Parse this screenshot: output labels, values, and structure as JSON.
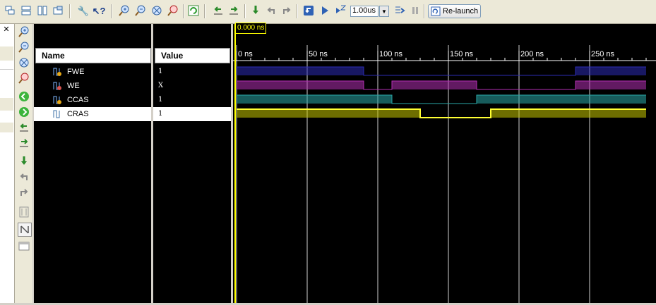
{
  "toolbar": {
    "time_value": "1.00us",
    "relaunch_label": "Re-launch"
  },
  "sidebar": {
    "close": "✕"
  },
  "columns": {
    "name": "Name",
    "value": "Value"
  },
  "signals": [
    {
      "name": "FWE",
      "value": "1",
      "color": "#2b2bb5"
    },
    {
      "name": "WE",
      "value": "X",
      "color": "#b32fb3"
    },
    {
      "name": "CCAS",
      "value": "1",
      "color": "#2aa7a7"
    },
    {
      "name": "CRAS",
      "value": "1",
      "color": "#c8c800"
    }
  ],
  "cursor": {
    "label": "0.000 ns"
  },
  "timeline": {
    "ticks": [
      "0 ns",
      "50 ns",
      "100 ns",
      "150 ns",
      "200 ns",
      "250 ns"
    ]
  },
  "waveforms": [
    {
      "signal": "FWE",
      "segments": [
        [
          0,
          90,
          "high"
        ],
        [
          90,
          240,
          "low"
        ],
        [
          240,
          290,
          "high"
        ]
      ]
    },
    {
      "signal": "WE",
      "segments": [
        [
          0,
          90,
          "high"
        ],
        [
          90,
          110,
          "low"
        ],
        [
          110,
          170,
          "high"
        ],
        [
          170,
          240,
          "low"
        ],
        [
          240,
          290,
          "high"
        ]
      ]
    },
    {
      "signal": "CCAS",
      "segments": [
        [
          0,
          110,
          "high"
        ],
        [
          110,
          170,
          "low"
        ],
        [
          170,
          290,
          "high"
        ]
      ]
    },
    {
      "signal": "CRAS",
      "segments": [
        [
          0,
          130,
          "high"
        ],
        [
          130,
          180,
          "low"
        ],
        [
          180,
          290,
          "high"
        ]
      ]
    }
  ]
}
